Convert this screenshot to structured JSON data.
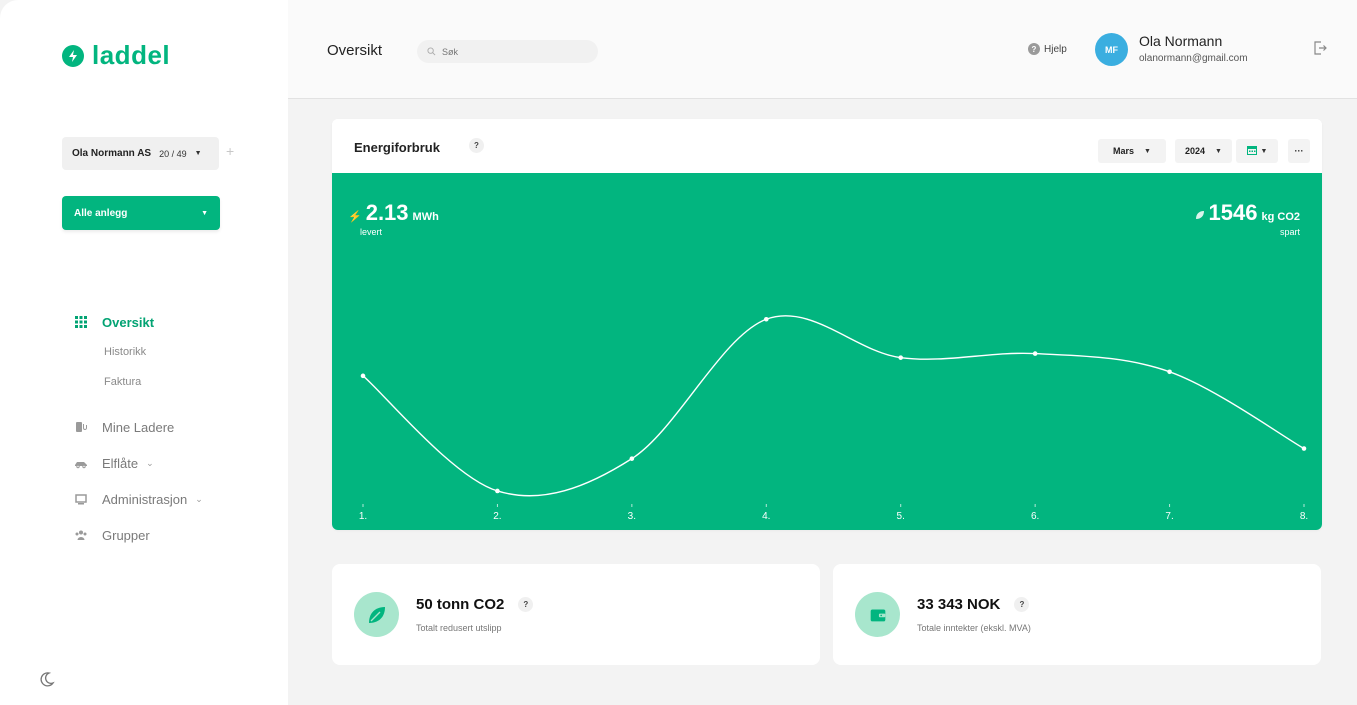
{
  "brand": {
    "name": "laddel",
    "color": "#02b57f"
  },
  "sidebar": {
    "org": {
      "name": "Ola Normann AS",
      "count": "20 / 49"
    },
    "anlegg_label": "Alle anlegg",
    "nav": {
      "oversikt": "Oversikt",
      "historikk": "Historikk",
      "faktura": "Faktura",
      "mine_ladere": "Mine Ladere",
      "elflate": "Elflåte",
      "administrasjon": "Administrasjon",
      "grupper": "Grupper"
    },
    "icons": [
      "grid-icon",
      "charger-icon",
      "car-icon",
      "monitor-icon",
      "group-icon",
      "moon-icon"
    ]
  },
  "header": {
    "title": "Oversikt",
    "search_placeholder": "Søk",
    "help_label": "Hjelp",
    "user": {
      "initials": "MF",
      "name": "Ola Normann",
      "email": "olanormann@gmail.com"
    }
  },
  "energy": {
    "title": "Energiforbruk",
    "help": "?",
    "month": "Mars",
    "year": "2024",
    "more": "···",
    "delivered": {
      "value": "2.13",
      "unit": "MWh",
      "label": "levert"
    },
    "saved": {
      "value": "1546",
      "unit": "kg CO2",
      "label": "spart"
    }
  },
  "chart_data": {
    "type": "line",
    "title": "",
    "categories": [
      "1.",
      "2.",
      "3.",
      "4.",
      "5.",
      "6.",
      "7.",
      "8."
    ],
    "series": [
      {
        "values": [
          0.59,
          0.02,
          0.18,
          0.87,
          0.68,
          0.7,
          0.61,
          0.23
        ]
      }
    ],
    "ylim": [
      0,
      1
    ],
    "grid": false,
    "line_color": "#ffffff"
  },
  "cards": [
    {
      "value": "50 tonn CO2",
      "help": "?",
      "label": "Totalt redusert utslipp",
      "icon": "leaf-icon"
    },
    {
      "value": "33 343 NOK",
      "help": "?",
      "label": "Totale inntekter (ekskl. MVA)",
      "icon": "wallet-icon"
    }
  ]
}
